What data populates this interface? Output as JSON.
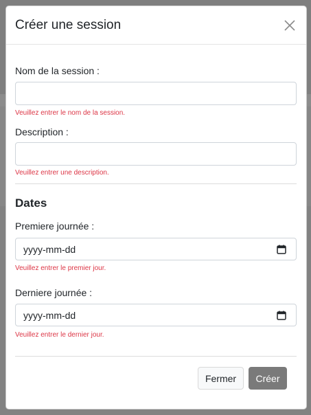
{
  "modal": {
    "title": "Créer une session",
    "close_icon": "close-icon"
  },
  "form": {
    "name": {
      "label": "Nom de la session :",
      "value": "",
      "error": "Veuillez entrer le nom de la session."
    },
    "description": {
      "label": "Description :",
      "value": "",
      "error": "Veuillez entrer une description."
    },
    "dates_title": "Dates",
    "first_day": {
      "label": "Premiere journée :",
      "value": "yyyy-mm-dd",
      "error": "Veuillez entrer le premier jour.",
      "icon": "calendar-icon"
    },
    "last_day": {
      "label": "Derniere journée :",
      "value": "yyyy-mm-dd",
      "error": "Veuillez entrer le dernier jour.",
      "icon": "calendar-icon"
    }
  },
  "footer": {
    "close_label": "Fermer",
    "create_label": "Créer"
  },
  "colors": {
    "error": "#dc3545",
    "primary_disabled": "#7a7a7a",
    "backdrop": "#7f7f7f"
  }
}
